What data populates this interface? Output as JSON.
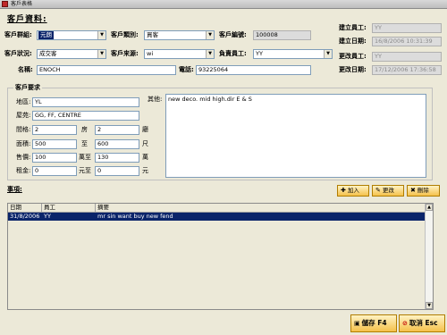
{
  "window": {
    "title": "客戶表格"
  },
  "header": "客戶資料:",
  "form": {
    "group_label": "客戶群組:",
    "group_value": "元朗",
    "category_label": "客戶類別:",
    "category_value": "買客",
    "number_label": "客戶編號:",
    "number_value": "100008",
    "created_by_label": "建立員工:",
    "created_by_value": "YY",
    "created_date_label": "建立日期:",
    "created_date_value": "16/8/2006 10:31:39",
    "status_label": "客戶狀況:",
    "status_value": "成交客",
    "source_label": "客戶來源:",
    "source_value": "wi",
    "staff_label": "負責員工:",
    "staff_value": "YY",
    "modified_by_label": "更改員工:",
    "modified_by_value": "YY",
    "modified_date_label": "更改日期:",
    "modified_date_value": "17/12/2006 17:36:58",
    "name_label": "名稱:",
    "name_value": "ENOCH",
    "phone_label": "電話:",
    "phone_value": "93225064"
  },
  "requirements": {
    "group_label": "客戶要求",
    "district_label": "地區:",
    "district_value": "YL",
    "estate_label": "屋苑:",
    "estate_value": "GG, FF, CENTRE",
    "rooms_label": "間格:",
    "rooms_value": "2",
    "rooms_unit": "房",
    "halls_value": "2",
    "halls_unit": "廳",
    "area_label": "面積:",
    "area_from": "500",
    "area_to_label": "至",
    "area_to": "600",
    "area_unit": "尺",
    "price_label": "售價:",
    "price_from": "100",
    "price_to_label": "萬至",
    "price_to": "130",
    "price_unit": "萬",
    "rent_label": "租金:",
    "rent_from": "0",
    "rent_to_label": "元至",
    "rent_to": "0",
    "rent_unit": "元",
    "other_label": "其他:",
    "other_value": "new deco. mid high.dir E & S"
  },
  "events": {
    "label": "事項:",
    "add_label": "加入",
    "edit_label": "更改",
    "delete_label": "刪除",
    "columns": [
      "日期",
      "員工",
      "摘要"
    ],
    "rows": [
      {
        "date": "31/8/2006",
        "staff": "YY",
        "summary": "mr sin want buy new fend"
      }
    ]
  },
  "footer": {
    "save_label": "儲存 F4",
    "cancel_label": "取消 Esc"
  }
}
